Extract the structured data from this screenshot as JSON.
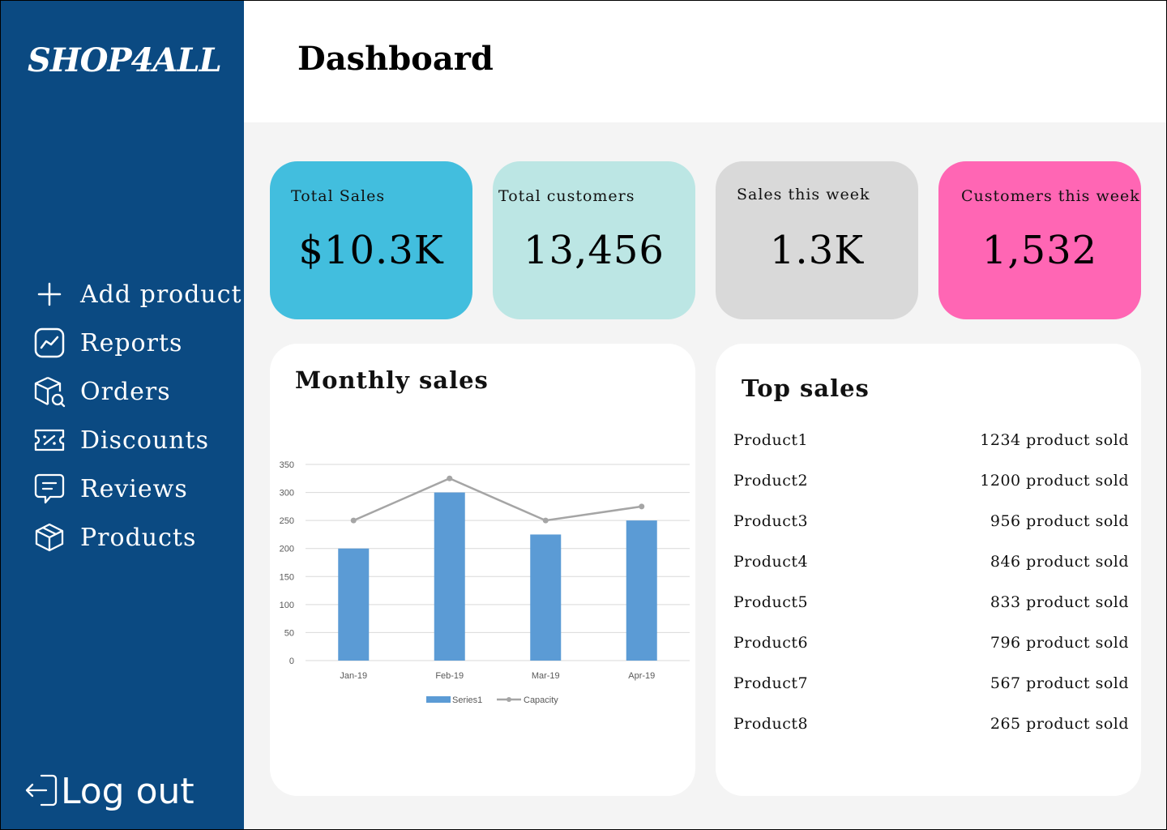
{
  "sidebar": {
    "logo": "SHOP4ALL",
    "items": [
      {
        "label": "Add product",
        "icon": "plus-icon"
      },
      {
        "label": "Reports",
        "icon": "chart-line-icon"
      },
      {
        "label": "Orders",
        "icon": "package-search-icon"
      },
      {
        "label": "Discounts",
        "icon": "ticket-percent-icon"
      },
      {
        "label": "Reviews",
        "icon": "message-square-icon"
      },
      {
        "label": "Products",
        "icon": "box-icon"
      }
    ],
    "logout": {
      "label": "Log out",
      "icon": "logout-icon"
    }
  },
  "header": {
    "title": "Dashboard"
  },
  "stats": [
    {
      "label": "Total Sales",
      "value": "$10.3K",
      "color": "#42bede"
    },
    {
      "label": "Total customers",
      "value": "13,456",
      "color": "#bce6e4"
    },
    {
      "label": "Sales this week",
      "value": "1.3K",
      "color": "#d9d9d9"
    },
    {
      "label": "Customers this week",
      "value": "1,532",
      "color": "#ff66b4"
    }
  ],
  "monthly_sales": {
    "title": "Monthly sales"
  },
  "chart_data": {
    "type": "bar",
    "categories": [
      "Jan-19",
      "Feb-19",
      "Mar-19",
      "Apr-19"
    ],
    "series": [
      {
        "name": "Series1",
        "type": "bar",
        "values": [
          200,
          300,
          225,
          250
        ],
        "color": "#5b9bd5"
      },
      {
        "name": "Capacity",
        "type": "line",
        "values": [
          250,
          325,
          250,
          275
        ],
        "color": "#a5a5a5"
      }
    ],
    "y_ticks": [
      0,
      50,
      100,
      150,
      200,
      250,
      300,
      350
    ],
    "ylim": [
      0,
      350
    ],
    "grid": true,
    "legend": "bottom"
  },
  "top_sales": {
    "title": "Top sales",
    "items": [
      {
        "name": "Product1",
        "value": "1234 product sold"
      },
      {
        "name": "Product2",
        "value": "1200 product sold"
      },
      {
        "name": "Product3",
        "value": "956 product sold"
      },
      {
        "name": "Product4",
        "value": "846 product sold"
      },
      {
        "name": "Product5",
        "value": "833 product sold"
      },
      {
        "name": "Product6",
        "value": "796 product sold"
      },
      {
        "name": "Product7",
        "value": "567 product sold"
      },
      {
        "name": "Product8",
        "value": "265 product sold"
      }
    ]
  }
}
